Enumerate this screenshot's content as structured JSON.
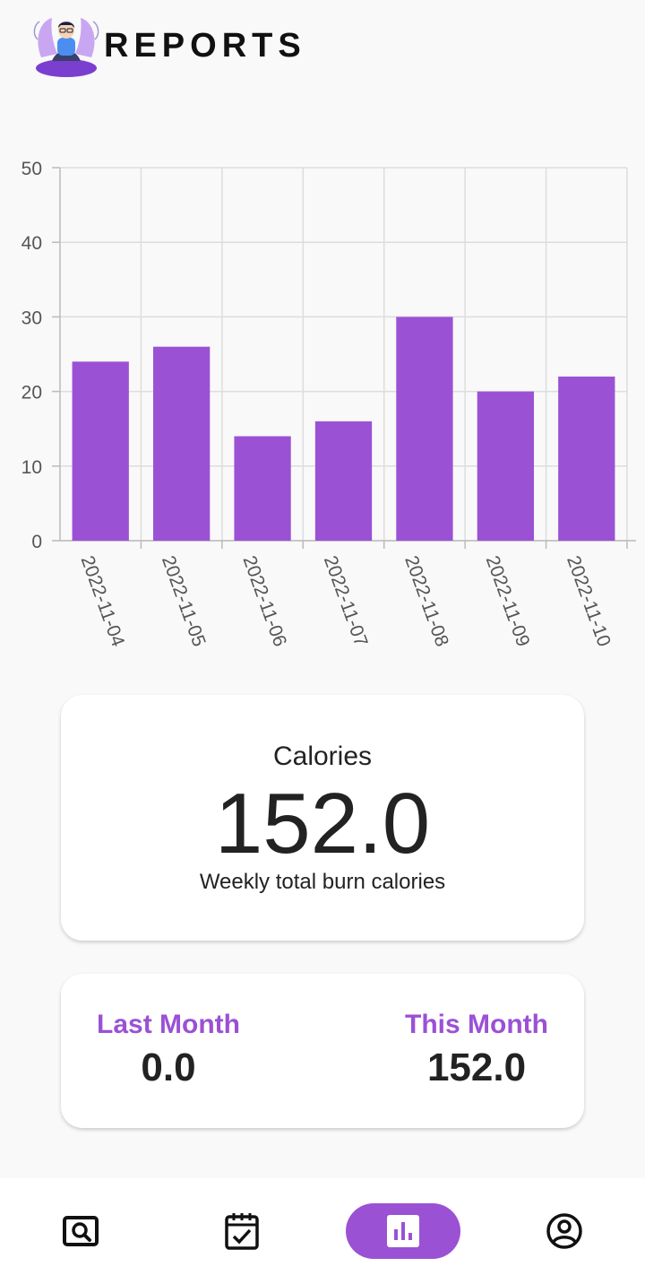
{
  "header": {
    "title": "REPORTS",
    "logo_icon": "meditation-avatar-icon"
  },
  "chart_data": {
    "type": "bar",
    "categories": [
      "2022-11-04",
      "2022-11-05",
      "2022-11-06",
      "2022-11-07",
      "2022-11-08",
      "2022-11-09",
      "2022-11-10"
    ],
    "values": [
      24,
      26,
      14,
      16,
      30,
      20,
      22
    ],
    "ylim": [
      0,
      50
    ],
    "yticks": [
      0,
      10,
      20,
      30,
      40,
      50
    ],
    "grid": true,
    "bar_color": "#9b51d4"
  },
  "calories_card": {
    "title": "Calories",
    "value": "152.0",
    "subtitle": "Weekly total burn calories"
  },
  "month_card": {
    "last_month_label": "Last Month",
    "last_month_value": "0.0",
    "this_month_label": "This Month",
    "this_month_value": "152.0"
  },
  "bottom_nav": {
    "items": [
      {
        "icon": "search-icon",
        "active": false
      },
      {
        "icon": "checklist-icon",
        "active": false
      },
      {
        "icon": "bar-chart-icon",
        "active": true
      },
      {
        "icon": "profile-icon",
        "active": false
      }
    ]
  },
  "colors": {
    "accent": "#9b51d4",
    "background": "#f9f9f9"
  }
}
